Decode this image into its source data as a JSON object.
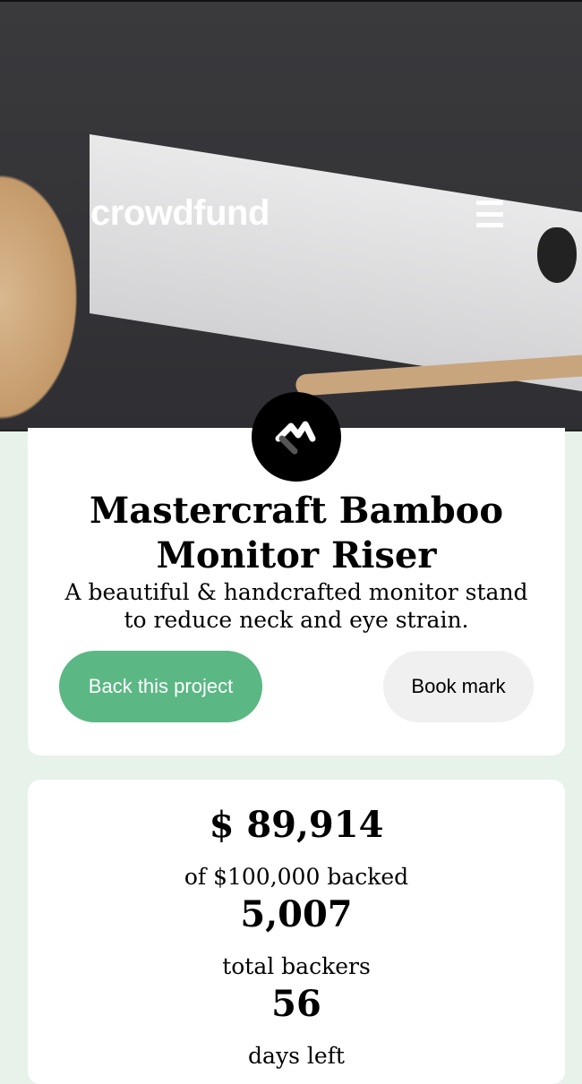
{
  "header": {
    "logo_text": "crowdfund",
    "menu_icon": "hamburger-menu-icon"
  },
  "project": {
    "badge_icon": "mastercraft-logo-icon",
    "title_line1": "Mastercraft Bamboo",
    "title_line2": "Monitor Riser",
    "description": "A beautiful & handcrafted monitor stand to reduce neck and eye strain.",
    "back_button_label": "Back this project",
    "bookmark_button_label": "Book mark"
  },
  "stats": {
    "amount_backed": "$ 89,914",
    "amount_backed_label": "of $100,000 backed",
    "total_backers": "5,007",
    "total_backers_label": "total backers",
    "days_left": "56",
    "days_left_label": "days left"
  },
  "colors": {
    "accent": "#5bb784",
    "page_background": "#e6f2ea",
    "bookmark_background": "#f0f0f0"
  }
}
